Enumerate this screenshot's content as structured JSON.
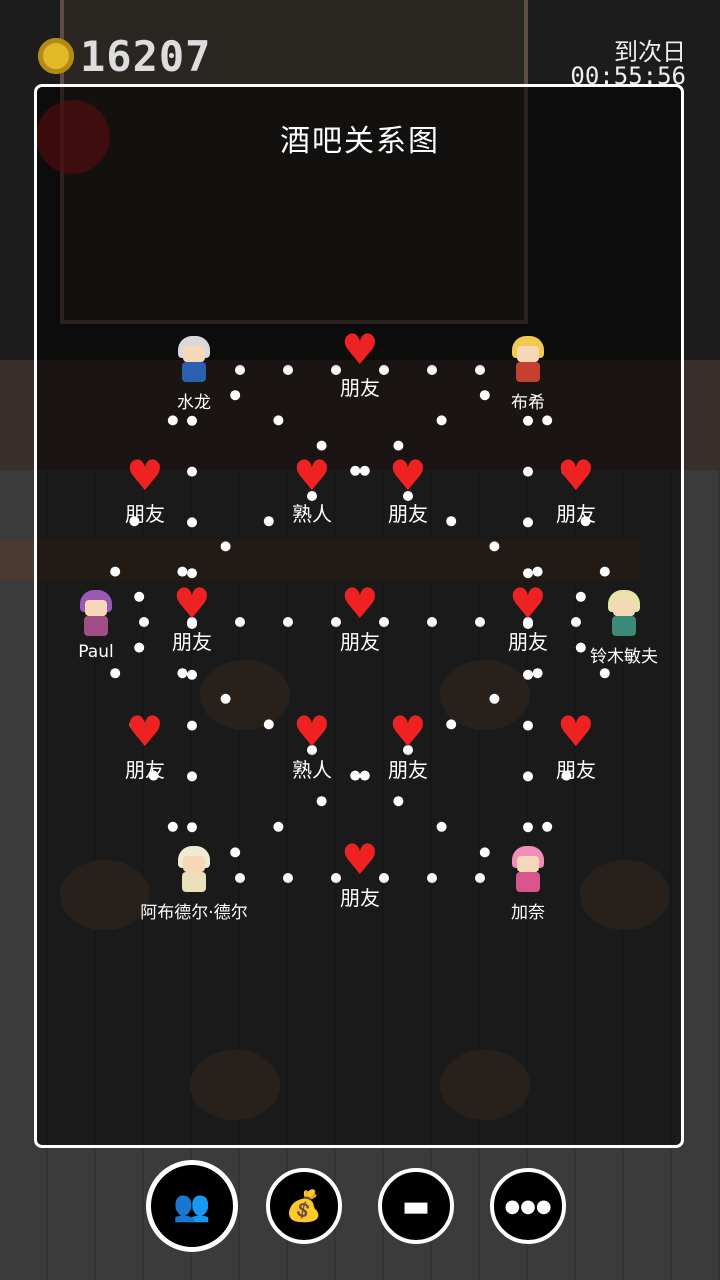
{
  "hud": {
    "coins": "16207",
    "next_day_label": "到次日",
    "timer": "00:55:56"
  },
  "panel": {
    "title": "酒吧关系图"
  },
  "characters": [
    {
      "id": "c1",
      "name": "水龙",
      "hair": "#d9d9d9",
      "body": "#2b5fb0"
    },
    {
      "id": "c2",
      "name": "布希",
      "hair": "#f2c94c",
      "body": "#c4412f"
    },
    {
      "id": "c3",
      "name": "Paul",
      "hair": "#9b59b6",
      "body": "#a04e86"
    },
    {
      "id": "c4",
      "name": "铃木敏夫",
      "hair": "#e8e3a8",
      "body": "#3a8a7a"
    },
    {
      "id": "c5",
      "name": "阿布德尔·德尔",
      "hair": "#f0ead0",
      "body": "#e9dfb8"
    },
    {
      "id": "c6",
      "name": "加奈",
      "hair": "#f28fb8",
      "body": "#d8568e"
    }
  ],
  "relations": [
    {
      "label": "朋友"
    },
    {
      "label": "朋友"
    },
    {
      "label": "熟人"
    },
    {
      "label": "朋友"
    },
    {
      "label": "朋友"
    },
    {
      "label": "朋友"
    },
    {
      "label": "朋友"
    },
    {
      "label": "朋友"
    },
    {
      "label": "朋友"
    },
    {
      "label": "熟人"
    },
    {
      "label": "朋友"
    },
    {
      "label": "朋友"
    },
    {
      "label": "朋友"
    }
  ],
  "bottom_bar": [
    {
      "name": "relationship-icon",
      "glyph": "👥"
    },
    {
      "name": "money-bag-icon",
      "glyph": "💰"
    },
    {
      "name": "folder-icon",
      "glyph": "▬"
    },
    {
      "name": "more-icon",
      "glyph": "●●●"
    }
  ],
  "colors": {
    "heart": "#ee2222",
    "panel_border": "#ffffff",
    "coin": "#e0b82a"
  }
}
